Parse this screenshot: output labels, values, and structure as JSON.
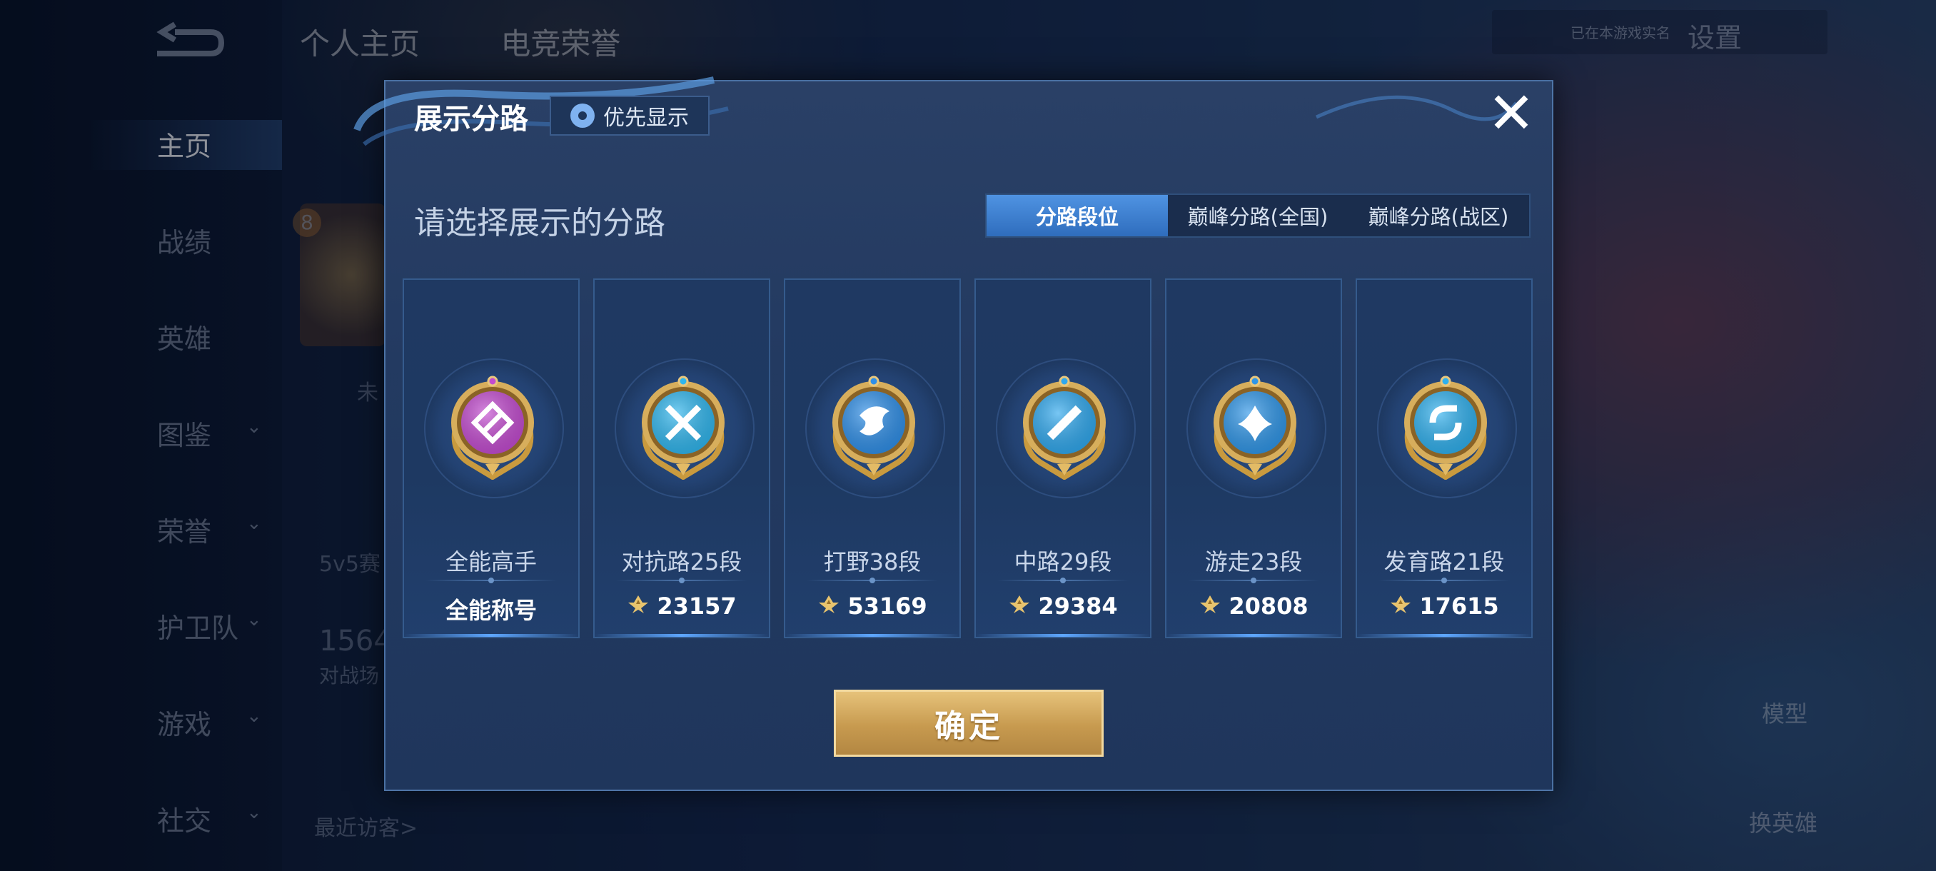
{
  "background": {
    "top_tabs": [
      "个人主页",
      "电竞荣誉"
    ],
    "left_nav": [
      {
        "label": "主页",
        "active": true,
        "expandable": false
      },
      {
        "label": "战绩",
        "active": false,
        "expandable": false
      },
      {
        "label": "英雄",
        "active": false,
        "expandable": false
      },
      {
        "label": "图鉴",
        "active": false,
        "expandable": true
      },
      {
        "label": "荣誉",
        "active": false,
        "expandable": true
      },
      {
        "label": "护卫队",
        "active": false,
        "expandable": true
      },
      {
        "label": "游戏",
        "active": false,
        "expandable": true
      },
      {
        "label": "社交",
        "active": false,
        "expandable": true
      }
    ],
    "settings_label": "设置",
    "status_text": "已在本游戏实名",
    "recent_visitors": "最近访客>",
    "level_badge": "8",
    "partial_texts": [
      "未",
      "5v5赛",
      "1564",
      "对战场"
    ],
    "right_labels": [
      "模型",
      "换英雄"
    ]
  },
  "dialog": {
    "title": "展示分路",
    "priority_button": "优先显示",
    "close_icon": "close-icon",
    "subtitle": "请选择展示的分路",
    "segments": [
      {
        "label": "分路段位",
        "active": true
      },
      {
        "label": "巅峰分路(全国)",
        "active": false
      },
      {
        "label": "巅峰分路(战区)",
        "active": false
      }
    ],
    "cards": [
      {
        "name": "全能高手",
        "value": "全能称号",
        "icon": "all-round-badge-icon",
        "color": "#c34bd0",
        "show_peak_icon": false
      },
      {
        "name": "对抗路25段",
        "value": "23157",
        "icon": "clash-lane-badge-icon",
        "color": "#2fb6ee",
        "show_peak_icon": true
      },
      {
        "name": "打野38段",
        "value": "53169",
        "icon": "jungle-badge-icon",
        "color": "#2f8fe8",
        "show_peak_icon": true
      },
      {
        "name": "中路29段",
        "value": "29384",
        "icon": "mid-lane-badge-icon",
        "color": "#2fa8ee",
        "show_peak_icon": true
      },
      {
        "name": "游走23段",
        "value": "20808",
        "icon": "roam-badge-icon",
        "color": "#2f96e8",
        "show_peak_icon": true
      },
      {
        "name": "发育路21段",
        "value": "17615",
        "icon": "farm-lane-badge-icon",
        "color": "#2fb0ee",
        "show_peak_icon": true
      }
    ],
    "confirm_label": "确定",
    "colors": {
      "accent": "#3f84d6",
      "gold": "#d6ad62",
      "panel": "#233a61"
    }
  }
}
